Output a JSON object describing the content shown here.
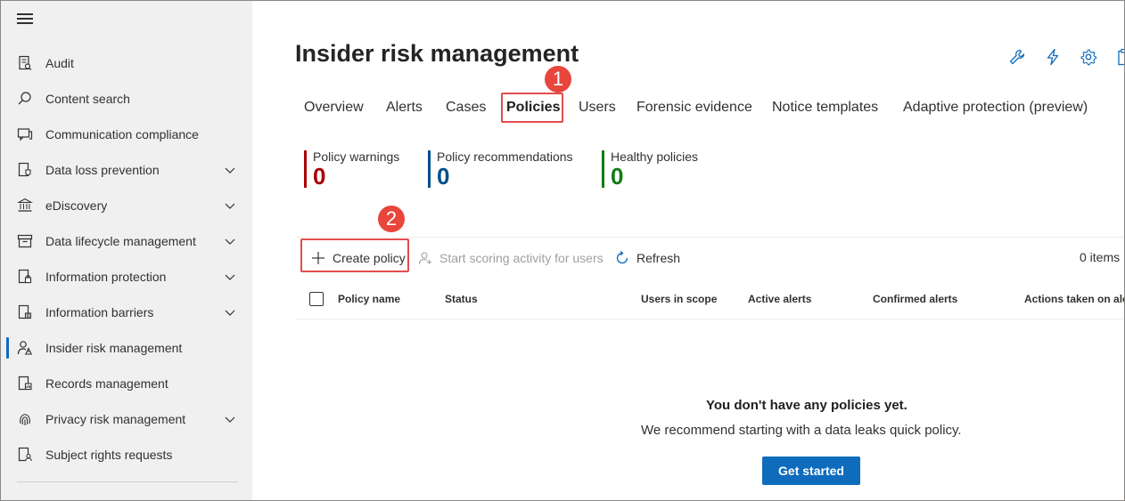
{
  "sidebar": {
    "menu_icon": "hamburger-icon",
    "items": [
      {
        "label": "Audit",
        "icon": "audit-icon",
        "expandable": false
      },
      {
        "label": "Content search",
        "icon": "search-icon",
        "expandable": false
      },
      {
        "label": "Communication compliance",
        "icon": "chat-icon",
        "expandable": false
      },
      {
        "label": "Data loss prevention",
        "icon": "shield-doc-icon",
        "expandable": true
      },
      {
        "label": "eDiscovery",
        "icon": "bank-icon",
        "expandable": true
      },
      {
        "label": "Data lifecycle management",
        "icon": "archive-icon",
        "expandable": true
      },
      {
        "label": "Information protection",
        "icon": "lock-doc-icon",
        "expandable": true
      },
      {
        "label": "Information barriers",
        "icon": "barrier-doc-icon",
        "expandable": true
      },
      {
        "label": "Insider risk management",
        "icon": "person-warning-icon",
        "expandable": false,
        "active": true
      },
      {
        "label": "Records management",
        "icon": "records-icon",
        "expandable": false
      },
      {
        "label": "Privacy risk management",
        "icon": "fingerprint-icon",
        "expandable": true
      },
      {
        "label": "Subject rights requests",
        "icon": "person-doc-icon",
        "expandable": false
      }
    ]
  },
  "header": {
    "title": "Insider risk management",
    "toolbar_icons": [
      "wrench-icon",
      "lightning-icon",
      "gear-icon",
      "clipboard-icon"
    ]
  },
  "tabs": [
    {
      "label": "Overview"
    },
    {
      "label": "Alerts"
    },
    {
      "label": "Cases"
    },
    {
      "label": "Policies",
      "active": true
    },
    {
      "label": "Users"
    },
    {
      "label": "Forensic evidence"
    },
    {
      "label": "Notice templates"
    },
    {
      "label": "Adaptive protection (preview)"
    }
  ],
  "callouts": {
    "step1": "1",
    "step2": "2"
  },
  "summary": [
    {
      "label": "Policy warnings",
      "value": "0",
      "color": "#a80000"
    },
    {
      "label": "Policy recommendations",
      "value": "0",
      "color": "#004e8c"
    },
    {
      "label": "Healthy policies",
      "value": "0",
      "color": "#107c10"
    }
  ],
  "commands": {
    "create": "Create policy",
    "scoring": "Start scoring activity for users",
    "refresh": "Refresh",
    "items_count": "0 items"
  },
  "table": {
    "columns": [
      "Policy name",
      "Status",
      "Users in scope",
      "Active alerts",
      "Confirmed alerts",
      "Actions taken on ale"
    ]
  },
  "empty_state": {
    "title": "You don't have any policies yet.",
    "subtitle": "We recommend starting with a data leaks quick policy.",
    "button": "Get started"
  },
  "colors": {
    "accent": "#0f6cbd",
    "highlight": "#e34c4c"
  }
}
